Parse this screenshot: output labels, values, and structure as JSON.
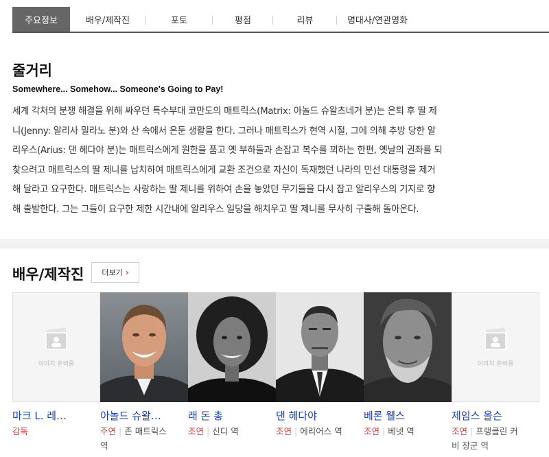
{
  "tabs": [
    {
      "label": "주요정보",
      "active": true
    },
    {
      "label": "배우/제작진",
      "active": false
    },
    {
      "label": "포토",
      "active": false
    },
    {
      "label": "평점",
      "active": false
    },
    {
      "label": "리뷰",
      "active": false
    },
    {
      "label": "명대사/연관영화",
      "active": false
    }
  ],
  "plot": {
    "title": "줄거리",
    "tagline": "Somewhere... Somehow... Someone's Going to Pay!",
    "lines": [
      "세계 각처의 분쟁 해결을 위해 싸우던 특수부대 코만도의 매트릭스(Matrix: 아놀드 슈왈츠네거 분)는 은퇴 후 딸 제",
      "니(Jenny: 알리사 밀라노 분)와 산 속에서 은둔 생활을 한다. 그러나 매트릭스가 현역 시절, 그에 의해 추방 당한 알",
      "리우스(Arius: 댄 헤다야 분)는 매트릭스에게 원한을 품고 옛 부하들과 손잡고 복수를 꾀하는 한편, 옛날의 권좌를 되",
      "찾으려고 매트릭스의 딸 제니를 납치하여 매트릭스에게 교환 조건으로 자신이 독재했던 나라의 민선 대통령을 제거",
      "해 달라고 요구한다. 매트릭스는 사랑하는 딸 제니를 위하여 손을 놓았던 무기들을 다시 잡고 알리우스의 기지로 향",
      "해 출발한다. 그는 그들이 요구한 제한 시간내에 알리우스 일당을 해치우고 딸 제니를 무사히 구출해 돌아온다."
    ]
  },
  "cast": {
    "title": "배우/제작진",
    "more_label": "더보기",
    "placeholder_text": "이미지 준비중",
    "people": [
      {
        "name": "마크 L. 레…",
        "role_type": "감독",
        "role_line1": "",
        "role_line2": "",
        "photo": "placeholder"
      },
      {
        "name": "아놀드 슈왈…",
        "role_type": "주연",
        "role_line1": "존 매트릭스",
        "role_line2": "역",
        "photo": "man-smiling-gray"
      },
      {
        "name": "래 돈 총",
        "role_type": "조연",
        "role_line1": "신디 역",
        "role_line2": "",
        "photo": "woman-bw"
      },
      {
        "name": "댄 헤다야",
        "role_type": "조연",
        "role_line1": "에리어스 역",
        "role_line2": "",
        "photo": "man-suit-bw"
      },
      {
        "name": "베론 웰스",
        "role_type": "조연",
        "role_line1": "베넷 역",
        "role_line2": "",
        "photo": "man-bearded-bw"
      },
      {
        "name": "제임스 올슨",
        "role_type": "조연",
        "role_line1": "프랭클린 커",
        "role_line2": "비 장군 역",
        "photo": "placeholder"
      }
    ]
  },
  "colors": {
    "link": "#1a3eb8",
    "role": "#e03b3b",
    "active_tab": "#666666"
  }
}
